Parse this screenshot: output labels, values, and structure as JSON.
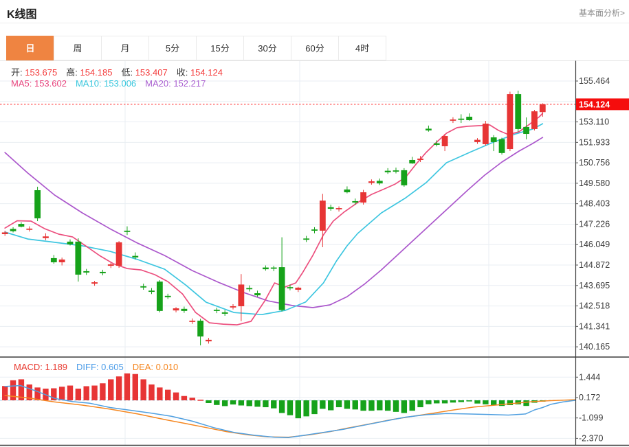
{
  "header": {
    "title": "K线图",
    "analysis_link": "基本面分析>"
  },
  "tabs": {
    "items": [
      {
        "label": "日",
        "active": true
      },
      {
        "label": "周",
        "active": false
      },
      {
        "label": "月",
        "active": false
      },
      {
        "label": "5分",
        "active": false
      },
      {
        "label": "15分",
        "active": false
      },
      {
        "label": "30分",
        "active": false
      },
      {
        "label": "60分",
        "active": false
      },
      {
        "label": "4时",
        "active": false
      }
    ]
  },
  "legend": {
    "ohlc": [
      {
        "label": "开:",
        "value": "153.675"
      },
      {
        "label": "高:",
        "value": "154.185"
      },
      {
        "label": "低:",
        "value": "153.407"
      },
      {
        "label": "收:",
        "value": "154.124"
      }
    ],
    "ma": [
      {
        "label": "MA5:",
        "value": "153.602",
        "color": "#e8457e"
      },
      {
        "label": "MA10:",
        "value": "153.006",
        "color": "#36c6dd"
      },
      {
        "label": "MA20:",
        "value": "152.217",
        "color": "#a95fd0"
      }
    ],
    "macd": [
      {
        "label": "MACD:",
        "value": "1.189",
        "color": "#e8392f"
      },
      {
        "label": "DIFF:",
        "value": "0.605",
        "color": "#4d9de8"
      },
      {
        "label": "DEA:",
        "value": "0.010",
        "color": "#f5861f"
      }
    ]
  },
  "price_tag": "154.124",
  "chart_data": {
    "type": "candlestick",
    "title": "K线图",
    "legend_position": "top-left-overlay",
    "grid": true,
    "main_axis": {
      "ylim": [
        140.165,
        155.464
      ],
      "ticks": [
        {
          "value": 155.464,
          "label": "155.464"
        },
        {
          "value": 154.287,
          "label": ""
        },
        {
          "value": 153.11,
          "label": "153.110"
        },
        {
          "value": 151.933,
          "label": "151.933"
        },
        {
          "value": 150.756,
          "label": "150.756"
        },
        {
          "value": 149.58,
          "label": "149.580"
        },
        {
          "value": 148.403,
          "label": "148.403"
        },
        {
          "value": 147.226,
          "label": "147.226"
        },
        {
          "value": 146.049,
          "label": "146.049"
        },
        {
          "value": 144.872,
          "label": "144.872"
        },
        {
          "value": 143.695,
          "label": "143.695"
        },
        {
          "value": 142.518,
          "label": "142.518"
        },
        {
          "value": 141.341,
          "label": "141.341"
        },
        {
          "value": 140.165,
          "label": "140.165"
        }
      ],
      "last_price": 154.124
    },
    "candles_ohlc": [
      [
        146.65,
        146.85,
        146.55,
        146.75
      ],
      [
        146.95,
        147.05,
        146.75,
        146.82
      ],
      [
        147.24,
        147.34,
        147.04,
        147.08
      ],
      [
        146.9,
        147.1,
        146.8,
        146.97
      ],
      [
        149.18,
        149.38,
        147.4,
        147.56
      ],
      [
        146.42,
        146.7,
        146.3,
        146.52
      ],
      [
        145.27,
        145.45,
        144.95,
        145.03
      ],
      [
        145.03,
        145.3,
        144.85,
        145.19
      ],
      [
        146.22,
        146.35,
        146.0,
        146.06
      ],
      [
        146.22,
        146.41,
        143.92,
        144.32
      ],
      [
        144.52,
        144.65,
        144.3,
        144.44
      ],
      [
        143.8,
        143.96,
        143.68,
        143.88
      ],
      [
        144.48,
        144.6,
        144.28,
        144.4
      ],
      [
        144.83,
        145.0,
        144.7,
        144.91
      ],
      [
        144.83,
        146.25,
        144.71,
        146.18
      ],
      [
        146.85,
        147.1,
        146.6,
        146.81
      ],
      [
        145.4,
        145.6,
        145.2,
        145.31
      ],
      [
        143.65,
        143.8,
        143.45,
        143.61
      ],
      [
        143.4,
        143.55,
        143.2,
        143.33
      ],
      [
        143.92,
        144.0,
        142.15,
        142.23
      ],
      [
        143.1,
        143.22,
        142.92,
        143.02
      ],
      [
        142.26,
        142.45,
        142.15,
        142.38
      ],
      [
        142.35,
        142.48,
        142.12,
        142.23
      ],
      [
        141.6,
        141.8,
        141.48,
        141.67
      ],
      [
        141.67,
        141.78,
        140.25,
        140.76
      ],
      [
        140.48,
        140.68,
        140.35,
        140.57
      ],
      [
        142.3,
        142.42,
        142.1,
        142.23
      ],
      [
        142.15,
        142.28,
        141.95,
        142.07
      ],
      [
        142.45,
        142.62,
        142.32,
        142.5
      ],
      [
        142.5,
        144.35,
        141.64,
        143.75
      ],
      [
        143.55,
        143.7,
        143.35,
        143.49
      ],
      [
        143.25,
        143.4,
        143.05,
        143.13
      ],
      [
        144.73,
        144.85,
        144.55,
        144.63
      ],
      [
        144.73,
        144.83,
        144.52,
        144.67
      ],
      [
        144.75,
        146.47,
        142.2,
        142.28
      ],
      [
        143.6,
        143.75,
        143.42,
        143.53
      ],
      [
        143.45,
        143.62,
        143.32,
        143.57
      ],
      [
        146.4,
        146.55,
        146.2,
        146.33
      ],
      [
        146.92,
        147.05,
        146.7,
        146.85
      ],
      [
        146.85,
        148.97,
        145.9,
        148.58
      ],
      [
        148.2,
        148.35,
        148.0,
        148.11
      ],
      [
        148.08,
        148.25,
        147.95,
        148.15
      ],
      [
        149.22,
        149.4,
        149.0,
        149.06
      ],
      [
        148.55,
        148.7,
        148.35,
        148.47
      ],
      [
        148.47,
        149.2,
        148.35,
        149.06
      ],
      [
        149.6,
        149.8,
        149.5,
        149.69
      ],
      [
        149.72,
        149.85,
        149.48,
        149.57
      ],
      [
        150.3,
        150.45,
        150.12,
        150.21
      ],
      [
        150.32,
        150.48,
        150.15,
        150.25
      ],
      [
        150.33,
        150.45,
        149.38,
        149.46
      ],
      [
        150.92,
        151.1,
        150.7,
        150.72
      ],
      [
        150.92,
        151.15,
        150.8,
        151.0
      ],
      [
        152.72,
        152.9,
        152.55,
        152.62
      ],
      [
        151.88,
        152.05,
        151.7,
        151.79
      ],
      [
        151.71,
        152.42,
        151.43,
        152.3
      ],
      [
        153.18,
        153.38,
        153.05,
        153.25
      ],
      [
        153.3,
        153.55,
        153.05,
        153.26
      ],
      [
        153.41,
        153.6,
        153.18,
        153.21
      ],
      [
        151.95,
        152.18,
        151.85,
        152.08
      ],
      [
        151.83,
        153.17,
        151.75,
        153.01
      ],
      [
        152.22,
        152.35,
        151.43,
        151.95
      ],
      [
        152.12,
        152.2,
        151.23,
        151.32
      ],
      [
        151.55,
        154.85,
        151.43,
        154.71
      ],
      [
        154.71,
        154.91,
        152.55,
        152.7
      ],
      [
        152.82,
        153.37,
        152.11,
        152.42
      ],
      [
        152.7,
        153.8,
        152.62,
        153.72
      ],
      [
        153.675,
        154.185,
        153.407,
        154.124
      ]
    ],
    "ma5": [
      [
        0,
        147.0
      ],
      [
        1.5,
        147.42
      ],
      [
        3.2,
        147.4
      ],
      [
        4.9,
        146.96
      ],
      [
        6.6,
        146.65
      ],
      [
        8.3,
        146.49
      ],
      [
        9.9,
        145.98
      ],
      [
        11.6,
        145.42
      ],
      [
        13.3,
        144.95
      ],
      [
        15,
        144.67
      ],
      [
        16.7,
        144.59
      ],
      [
        18.4,
        144.32
      ],
      [
        20,
        143.92
      ],
      [
        21.8,
        143.21
      ],
      [
        23.4,
        142.14
      ],
      [
        25.1,
        141.55
      ],
      [
        26.8,
        141.47
      ],
      [
        28.5,
        141.43
      ],
      [
        30.2,
        141.63
      ],
      [
        31.9,
        142.81
      ],
      [
        33.1,
        143.84
      ],
      [
        34.4,
        143.61
      ],
      [
        35.7,
        143.84
      ],
      [
        36.5,
        144.4
      ],
      [
        37.8,
        145.43
      ],
      [
        39.1,
        146.61
      ],
      [
        40.3,
        147.4
      ],
      [
        41.6,
        147.91
      ],
      [
        43.3,
        148.47
      ],
      [
        45,
        148.94
      ],
      [
        46.6,
        149.26
      ],
      [
        47.9,
        149.53
      ],
      [
        49.2,
        149.93
      ],
      [
        50.4,
        150.64
      ],
      [
        51.7,
        151.35
      ],
      [
        53,
        151.95
      ],
      [
        54.2,
        152.46
      ],
      [
        55.5,
        152.78
      ],
      [
        56.8,
        152.86
      ],
      [
        58.5,
        152.9
      ],
      [
        59.5,
        152.94
      ],
      [
        60.6,
        152.62
      ],
      [
        61.8,
        152.38
      ],
      [
        63.1,
        152.54
      ],
      [
        64.4,
        152.98
      ],
      [
        65.6,
        153.41
      ],
      [
        66,
        153.602
      ]
    ],
    "ma10": [
      [
        0,
        146.77
      ],
      [
        2.8,
        146.37
      ],
      [
        6.1,
        146.18
      ],
      [
        9.5,
        145.98
      ],
      [
        12.9,
        145.66
      ],
      [
        16.3,
        145.19
      ],
      [
        19.6,
        144.63
      ],
      [
        22.2,
        143.72
      ],
      [
        24.7,
        142.73
      ],
      [
        28.1,
        142.14
      ],
      [
        31.5,
        142.02
      ],
      [
        34.4,
        142.26
      ],
      [
        36.9,
        142.74
      ],
      [
        39.1,
        143.84
      ],
      [
        40.7,
        145.11
      ],
      [
        42,
        145.98
      ],
      [
        43.3,
        146.69
      ],
      [
        46.2,
        147.87
      ],
      [
        49.2,
        148.74
      ],
      [
        51.7,
        149.61
      ],
      [
        54.2,
        150.76
      ],
      [
        57.2,
        151.39
      ],
      [
        60,
        151.95
      ],
      [
        62.7,
        152.42
      ],
      [
        64.8,
        152.7
      ],
      [
        66,
        153.006
      ]
    ],
    "ma20": [
      [
        0,
        151.35
      ],
      [
        2.8,
        150.17
      ],
      [
        6.1,
        148.9
      ],
      [
        9.5,
        147.87
      ],
      [
        12.9,
        146.96
      ],
      [
        16.3,
        146.13
      ],
      [
        19.6,
        145.42
      ],
      [
        23,
        144.55
      ],
      [
        26.4,
        143.84
      ],
      [
        29.3,
        143.29
      ],
      [
        32.3,
        142.81
      ],
      [
        35.3,
        142.54
      ],
      [
        37.8,
        142.42
      ],
      [
        39.9,
        142.58
      ],
      [
        42,
        143.05
      ],
      [
        44.1,
        143.76
      ],
      [
        46.2,
        144.59
      ],
      [
        48.3,
        145.5
      ],
      [
        50.4,
        146.41
      ],
      [
        52.6,
        147.36
      ],
      [
        54.7,
        148.27
      ],
      [
        56.8,
        149.18
      ],
      [
        58.9,
        150.05
      ],
      [
        61,
        150.8
      ],
      [
        63.1,
        151.43
      ],
      [
        64.8,
        151.87
      ],
      [
        66,
        152.217
      ]
    ],
    "macd_panel": {
      "ticks": [
        {
          "value": 1.444,
          "label": "1.444"
        },
        {
          "value": 0.172,
          "label": "0.172"
        },
        {
          "value": -1.099,
          "label": "-1.099"
        },
        {
          "value": -2.37,
          "label": "-2.370"
        }
      ],
      "histogram": [
        0.89,
        1.25,
        1.31,
        0.99,
        0.8,
        0.73,
        0.75,
        0.85,
        0.92,
        0.73,
        0.88,
        0.92,
        1.06,
        1.31,
        1.49,
        1.68,
        1.64,
        1.31,
        0.99,
        0.8,
        0.66,
        0.49,
        0.27,
        0.16,
        0.04,
        -0.17,
        -0.29,
        -0.36,
        -0.26,
        -0.32,
        -0.36,
        -0.4,
        -0.43,
        -0.5,
        -0.79,
        -0.93,
        -1.12,
        -1.0,
        -0.86,
        -0.53,
        -0.62,
        -0.43,
        -0.53,
        -0.57,
        -0.65,
        -0.65,
        -0.62,
        -0.65,
        -0.72,
        -0.79,
        -0.65,
        -0.43,
        -0.24,
        -0.19,
        -0.19,
        -0.14,
        -0.11,
        -0.06,
        -0.2,
        -0.25,
        -0.3,
        -0.35,
        -0.3,
        -0.25,
        -0.35,
        -0.15,
        -0.08
      ],
      "diff": [
        [
          0,
          0.86
        ],
        [
          1.9,
          0.92
        ],
        [
          4,
          0.55
        ],
        [
          6.1,
          0.12
        ],
        [
          8.3,
          -0.08
        ],
        [
          10.4,
          -0.18
        ],
        [
          12.9,
          -0.45
        ],
        [
          15.4,
          -0.62
        ],
        [
          18,
          -0.8
        ],
        [
          20.5,
          -1.0
        ],
        [
          23,
          -1.3
        ],
        [
          25.6,
          -1.7
        ],
        [
          28.1,
          -2.0
        ],
        [
          30.6,
          -2.18
        ],
        [
          33.1,
          -2.3
        ],
        [
          34.8,
          -2.32
        ],
        [
          36.5,
          -2.2
        ],
        [
          39.1,
          -2.0
        ],
        [
          41.6,
          -1.8
        ],
        [
          44.1,
          -1.55
        ],
        [
          46.6,
          -1.3
        ],
        [
          49.2,
          -1.05
        ],
        [
          51.7,
          -0.9
        ],
        [
          54.2,
          -0.82
        ],
        [
          56.8,
          -0.85
        ],
        [
          59.3,
          -0.88
        ],
        [
          61.8,
          -0.92
        ],
        [
          63.9,
          -0.85
        ],
        [
          65,
          -0.6
        ],
        [
          66,
          -0.45
        ],
        [
          67,
          -0.25
        ],
        [
          68.5,
          -0.1
        ],
        [
          70,
          0.0
        ]
      ],
      "dea": [
        [
          0,
          0.3
        ],
        [
          2.8,
          0.15
        ],
        [
          6.1,
          -0.1
        ],
        [
          9.5,
          -0.3
        ],
        [
          12.9,
          -0.55
        ],
        [
          16.3,
          -0.85
        ],
        [
          19.6,
          -1.2
        ],
        [
          22.2,
          -1.45
        ],
        [
          24.7,
          -1.7
        ],
        [
          27.2,
          -1.95
        ],
        [
          29.8,
          -2.15
        ],
        [
          32.3,
          -2.28
        ],
        [
          34.8,
          -2.3
        ],
        [
          37.4,
          -2.15
        ],
        [
          39.9,
          -1.95
        ],
        [
          42.4,
          -1.7
        ],
        [
          45,
          -1.45
        ],
        [
          47.5,
          -1.2
        ],
        [
          50,
          -1.0
        ],
        [
          52.6,
          -0.8
        ],
        [
          55.1,
          -0.6
        ],
        [
          57.6,
          -0.42
        ],
        [
          60.2,
          -0.3
        ],
        [
          62.7,
          -0.18
        ],
        [
          64.8,
          -0.08
        ],
        [
          67,
          -0.02
        ],
        [
          70,
          0.04
        ]
      ]
    },
    "colors": {
      "up": "#e73535",
      "down": "#16a21a",
      "ma5": "#ec4f7e",
      "ma10": "#3ec6e0",
      "ma20": "#ab57cc",
      "diff": "#4f9fe0",
      "dea": "#f5861f",
      "grid": "#e9eef3",
      "axis_text": "#3a3a3a",
      "last_price_line": "#f55",
      "last_price_tag_bg": "#f50d0d",
      "zero_line": "#b8d8ea",
      "border_dark": "#3c3c3c",
      "border_light": "#e5e5e5",
      "tab_active_bg": "#ef8441"
    }
  }
}
